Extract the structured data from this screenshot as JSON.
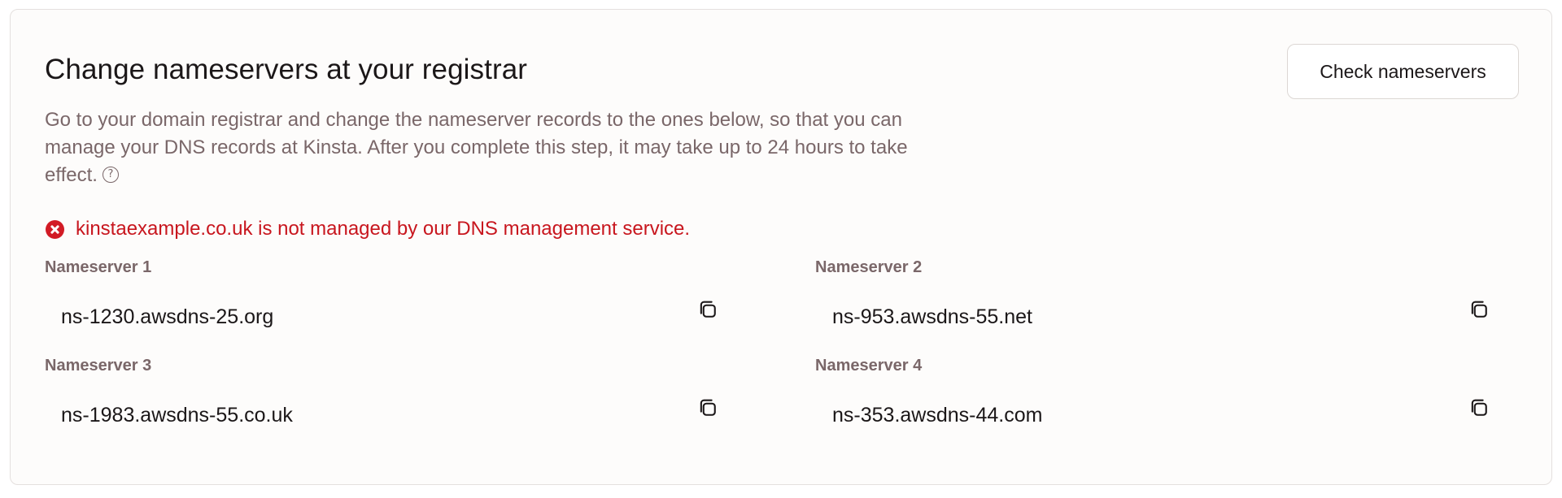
{
  "header": {
    "title": "Change nameservers at your registrar",
    "description": "Go to your domain registrar and change the nameserver records to the ones below, so that you can manage your DNS records at Kinsta. After you complete this step, it may take up to 24 hours to take effect.",
    "help_icon_glyph": "?",
    "check_button_label": "Check nameservers"
  },
  "error": {
    "message": "kinstaexample.co.uk is not managed by our DNS management service.",
    "color": "#d21b25"
  },
  "nameservers": [
    {
      "label": "Nameserver 1",
      "value": "ns-1230.awsdns-25.org"
    },
    {
      "label": "Nameserver 2",
      "value": "ns-953.awsdns-55.net"
    },
    {
      "label": "Nameserver 3",
      "value": "ns-1983.awsdns-55.co.uk"
    },
    {
      "label": "Nameserver 4",
      "value": "ns-353.awsdns-44.com"
    }
  ],
  "icons": {
    "help": "question-circle-icon",
    "error": "x-circle-icon",
    "copy": "copy-icon"
  }
}
